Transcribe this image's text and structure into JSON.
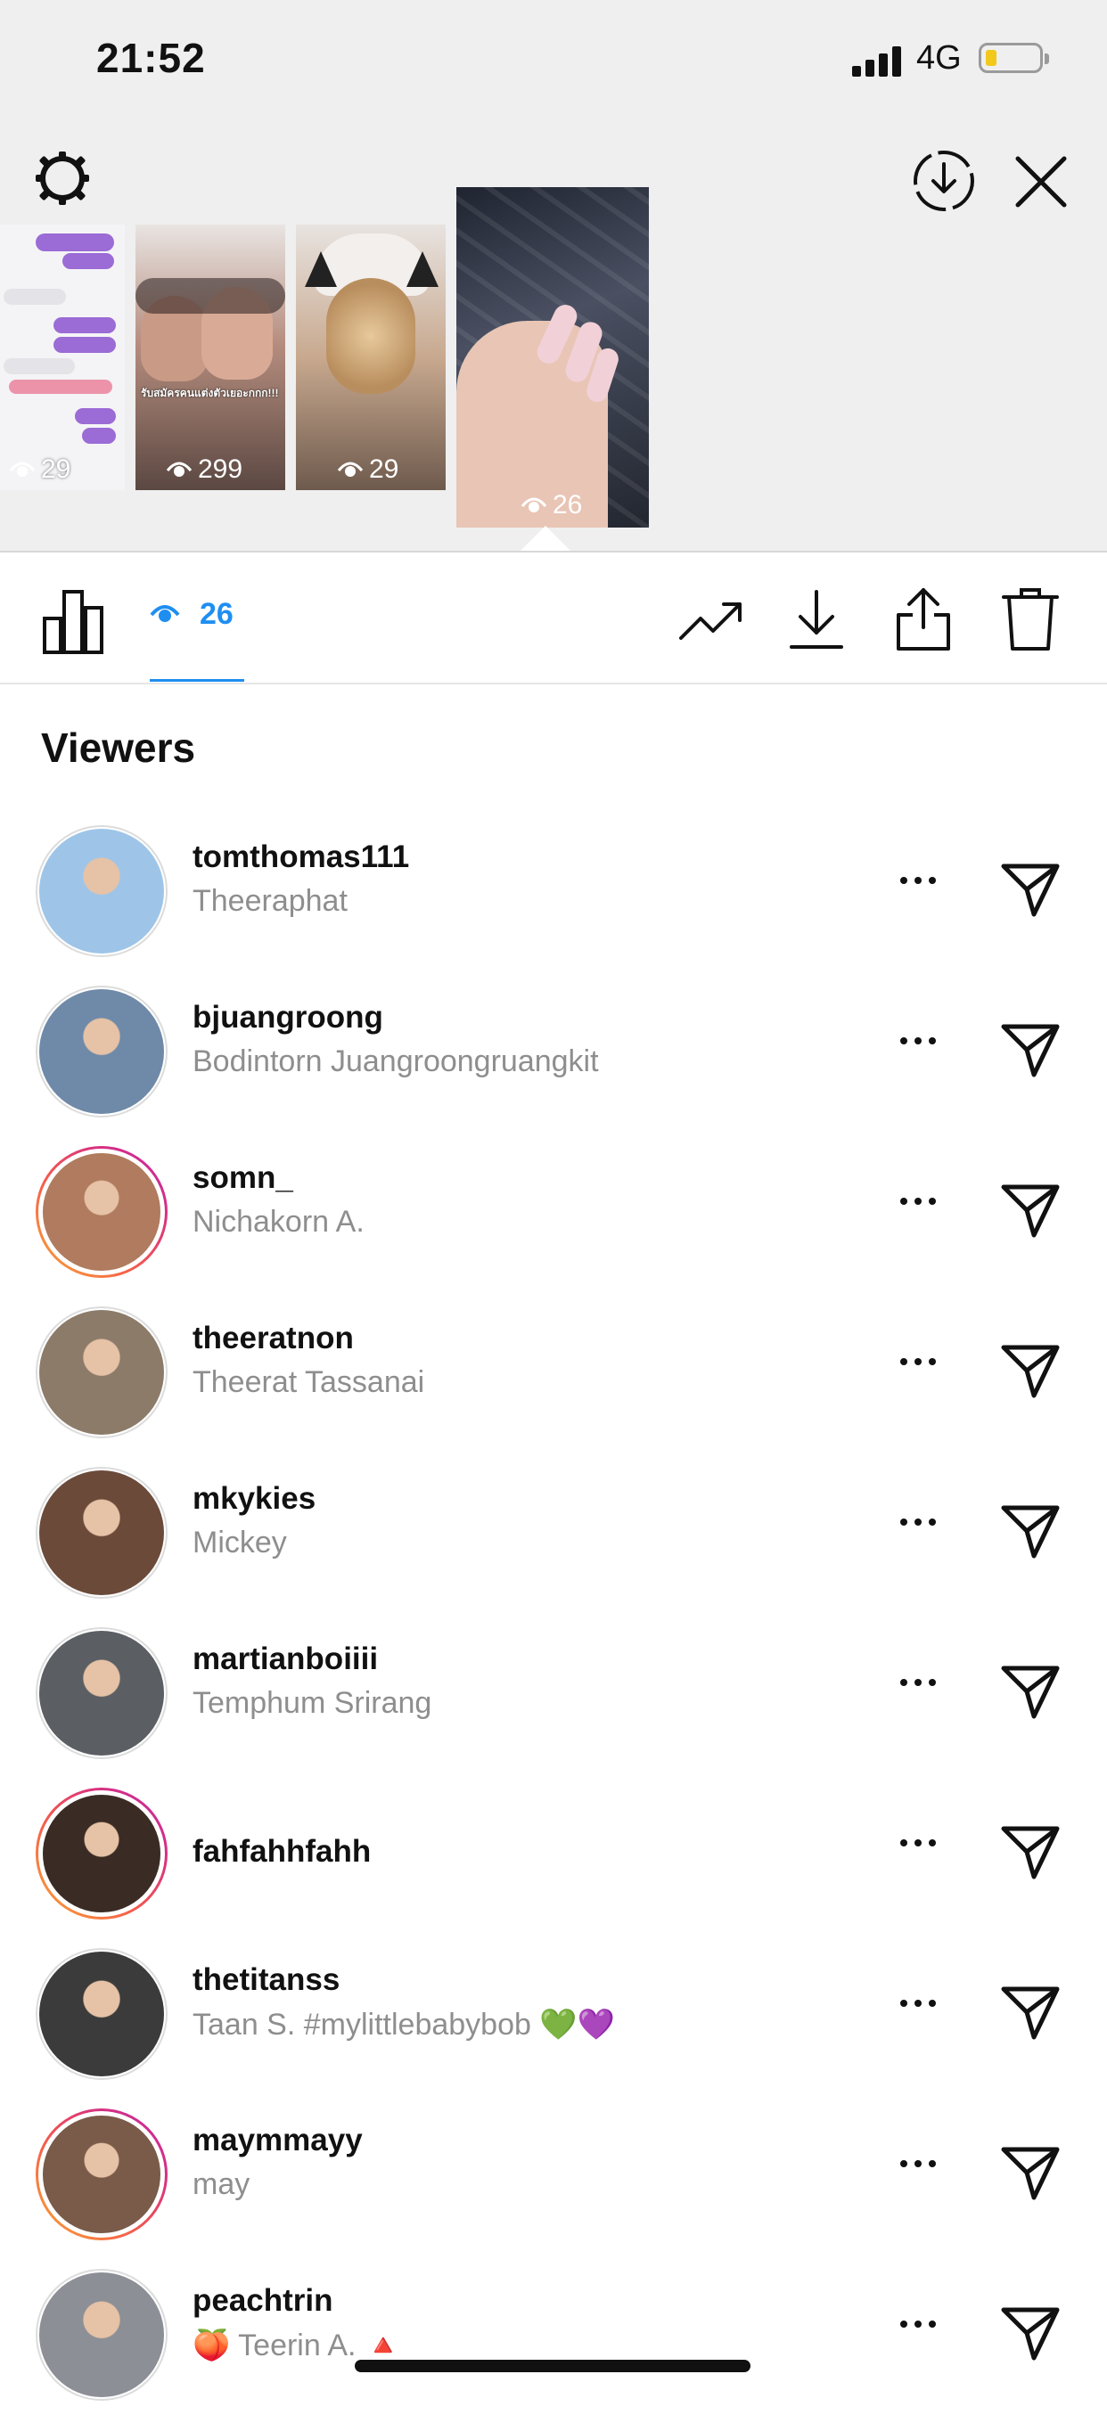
{
  "status": {
    "time": "21:52",
    "network": "4G"
  },
  "thumbnails": [
    {
      "views": "29",
      "bg": "#f4f4f6"
    },
    {
      "views": "299",
      "bg": "#6b5a55",
      "caption": "รับสมัครคนแต่งตัวเยอะกกก!!!"
    },
    {
      "views": "29",
      "bg": "#b89a7e"
    },
    {
      "views": "26",
      "bg": "#2b2f3a"
    }
  ],
  "toolbar": {
    "views_count": "26"
  },
  "section": {
    "title": "Viewers"
  },
  "viewers": [
    {
      "username": "tomthomas111",
      "name": "Theeraphat",
      "ring": false,
      "color": "#9ec5e8"
    },
    {
      "username": "bjuangroong",
      "name": "Bodintorn Juangroongruangkit",
      "ring": false,
      "color": "#6f8aa8"
    },
    {
      "username": "somn_",
      "name": "Nichakorn A.",
      "ring": true,
      "color": "#b07b5e"
    },
    {
      "username": "theeratnon",
      "name": "Theerat Tassanai",
      "ring": false,
      "color": "#8d7b6a"
    },
    {
      "username": "mkykies",
      "name": "Mickey",
      "ring": false,
      "color": "#6b4a3a"
    },
    {
      "username": "martianboiiii",
      "name": "Temphum Srirang",
      "ring": false,
      "color": "#5b5f63"
    },
    {
      "username": "fahfahhfahh",
      "name": "",
      "ring": true,
      "color": "#3a2c24"
    },
    {
      "username": "thetitanss",
      "name": "Taan S. #mylittlebabybob 💚💜",
      "ring": false,
      "color": "#3b3b3b"
    },
    {
      "username": "maymmayy",
      "name": "may",
      "ring": true,
      "color": "#7a5a48"
    },
    {
      "username": "peachtrin",
      "name": "🍑 Teerin A. 🔺",
      "ring": false,
      "color": "#8c8f96"
    }
  ]
}
